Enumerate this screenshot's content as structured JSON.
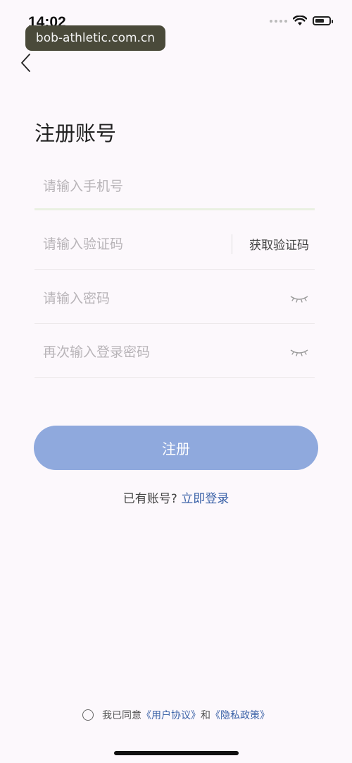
{
  "status_bar": {
    "time": "14:02",
    "url_badge": "bob-athletic.com.cn"
  },
  "page": {
    "title": "注册账号"
  },
  "form": {
    "phone_placeholder": "请输入手机号",
    "code_placeholder": "请输入验证码",
    "get_code_label": "获取验证码",
    "password_placeholder": "请输入密码",
    "confirm_password_placeholder": "再次输入登录密码"
  },
  "actions": {
    "register_label": "注册",
    "have_account_text": "已有账号?",
    "login_link_label": "立即登录"
  },
  "agreement": {
    "prefix": "我已同意",
    "user_agreement": "《用户协议》",
    "and": "和",
    "privacy_policy": "《隐私政策》"
  },
  "icons": {
    "back": "chevron-left-icon",
    "eye_closed": "eye-closed-icon",
    "wifi": "wifi-icon",
    "battery": "battery-icon"
  },
  "colors": {
    "accent": "#8fa9dd",
    "link": "#3c63a8",
    "background": "#fcf8fc"
  }
}
